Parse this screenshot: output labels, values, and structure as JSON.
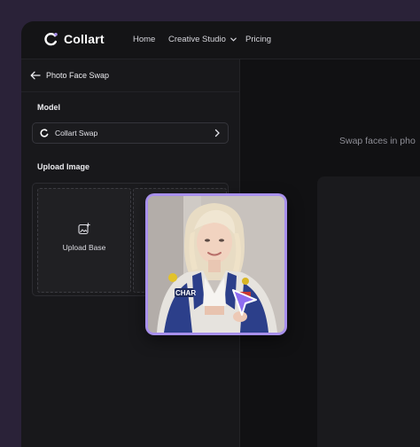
{
  "app": {
    "name": "Collart"
  },
  "nav": {
    "home": "Home",
    "creative_studio": "Creative Studio",
    "pricing": "Pricing"
  },
  "sidebar": {
    "back_title": "Photo Face Swap",
    "model_label": "Model",
    "model_value": "Collart Swap",
    "upload_label": "Upload Image",
    "upload_base_label": "Upload Base"
  },
  "main": {
    "subtitle": "Swap faces in pho"
  },
  "colors": {
    "accent": "#a890ec",
    "background": "#141416",
    "frame": "#2a2238"
  },
  "icons": [
    "collart-logo-icon",
    "chevron-down-icon",
    "arrow-left-icon",
    "model-spinner-icon",
    "chevron-right-icon",
    "add-image-icon",
    "cursor-arrow-icon"
  ]
}
